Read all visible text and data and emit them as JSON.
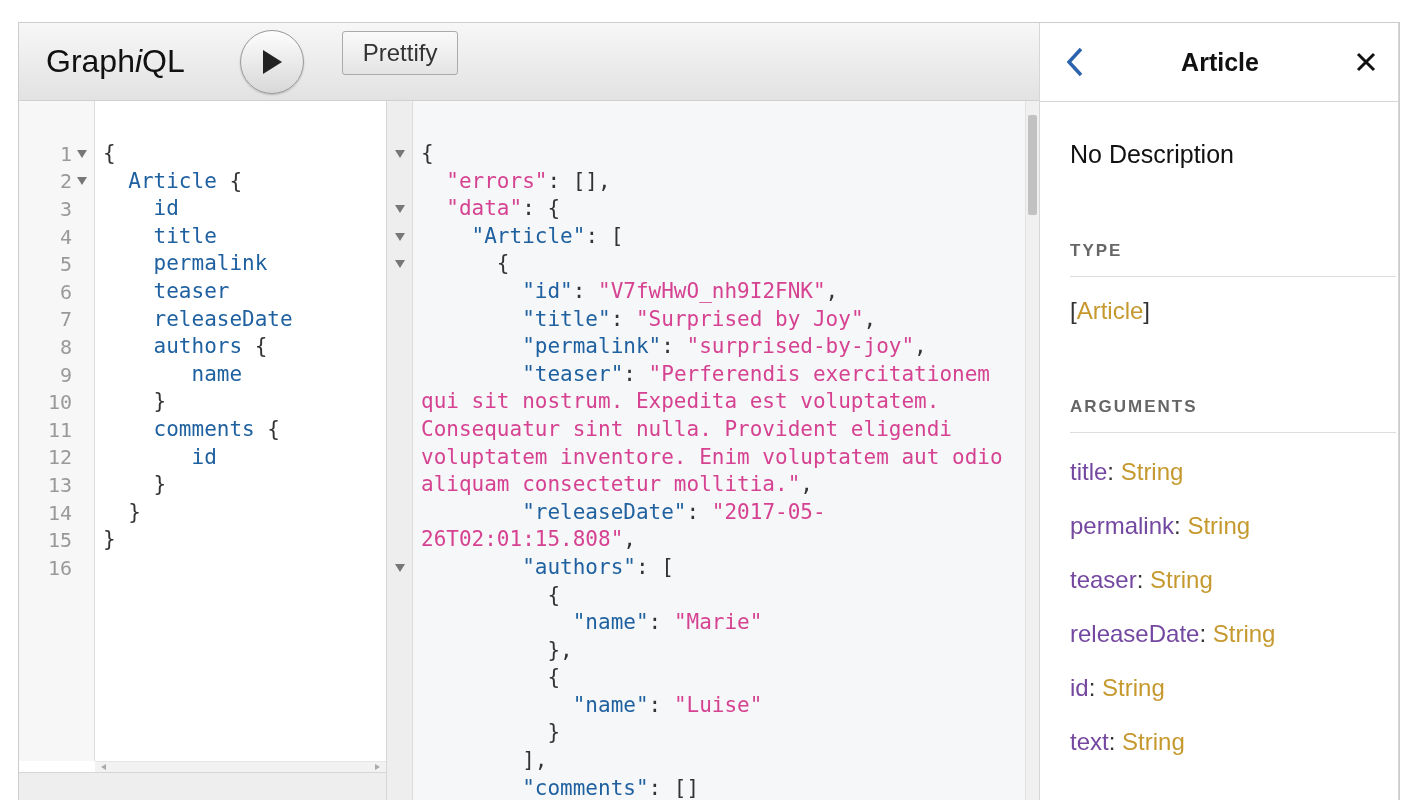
{
  "toolbar": {
    "logo": [
      {
        "text": "Graph",
        "italic": false
      },
      {
        "text": "i",
        "italic": true
      },
      {
        "text": "QL",
        "italic": false
      }
    ],
    "prettify_label": "Prettify"
  },
  "query_editor": {
    "lines": [
      {
        "number": "1",
        "fold": true,
        "tokens": [
          {
            "text": "{",
            "kind": "punct"
          }
        ]
      },
      {
        "number": "2",
        "fold": true,
        "tokens": [
          {
            "text": "  Article",
            "kind": "field"
          },
          {
            "text": " {",
            "kind": "punct"
          }
        ]
      },
      {
        "number": "3",
        "fold": false,
        "tokens": [
          {
            "text": "    id",
            "kind": "field"
          }
        ]
      },
      {
        "number": "4",
        "fold": false,
        "tokens": [
          {
            "text": "    title",
            "kind": "field"
          }
        ]
      },
      {
        "number": "5",
        "fold": false,
        "tokens": [
          {
            "text": "    permalink",
            "kind": "field"
          }
        ]
      },
      {
        "number": "6",
        "fold": false,
        "tokens": [
          {
            "text": "    teaser",
            "kind": "field"
          }
        ]
      },
      {
        "number": "7",
        "fold": false,
        "tokens": [
          {
            "text": "    releaseDate",
            "kind": "field"
          }
        ]
      },
      {
        "number": "8",
        "fold": false,
        "tokens": [
          {
            "text": "    authors",
            "kind": "field"
          },
          {
            "text": " {",
            "kind": "punct"
          }
        ]
      },
      {
        "number": "9",
        "fold": false,
        "tokens": [
          {
            "text": "       name",
            "kind": "field"
          }
        ]
      },
      {
        "number": "10",
        "fold": false,
        "tokens": [
          {
            "text": "    }",
            "kind": "punct"
          }
        ]
      },
      {
        "number": "11",
        "fold": false,
        "tokens": [
          {
            "text": "    comments",
            "kind": "field"
          },
          {
            "text": " {",
            "kind": "punct"
          }
        ]
      },
      {
        "number": "12",
        "fold": false,
        "tokens": [
          {
            "text": "       id",
            "kind": "field"
          }
        ]
      },
      {
        "number": "13",
        "fold": false,
        "tokens": [
          {
            "text": "    }",
            "kind": "punct"
          }
        ]
      },
      {
        "number": "14",
        "fold": false,
        "tokens": [
          {
            "text": "  }",
            "kind": "punct"
          }
        ]
      },
      {
        "number": "15",
        "fold": false,
        "tokens": [
          {
            "text": "}",
            "kind": "punct"
          }
        ]
      },
      {
        "number": "16",
        "fold": false
      }
    ]
  },
  "result_viewer": {
    "lines": [
      {
        "fold": true,
        "tokens": [
          {
            "text": "{",
            "kind": "punct"
          }
        ]
      },
      {
        "fold": false,
        "tokens": [
          {
            "text": "  \"errors\"",
            "kind": "string"
          },
          {
            "text": ": [],",
            "kind": "punct"
          }
        ]
      },
      {
        "fold": true,
        "tokens": [
          {
            "text": "  \"data\"",
            "kind": "string"
          },
          {
            "text": ": {",
            "kind": "punct"
          }
        ]
      },
      {
        "fold": true,
        "tokens": [
          {
            "text": "    \"Article\"",
            "kind": "key"
          },
          {
            "text": ": [",
            "kind": "punct"
          }
        ]
      },
      {
        "fold": true,
        "tokens": [
          {
            "text": "      {",
            "kind": "punct"
          }
        ]
      },
      {
        "fold": false,
        "tokens": [
          {
            "text": "        \"id\"",
            "kind": "key"
          },
          {
            "text": ": ",
            "kind": "punct"
          },
          {
            "text": "\"V7fwHwO_nh9I2FNK\"",
            "kind": "string"
          },
          {
            "text": ",",
            "kind": "punct"
          }
        ]
      },
      {
        "fold": false,
        "tokens": [
          {
            "text": "        \"title\"",
            "kind": "key"
          },
          {
            "text": ": ",
            "kind": "punct"
          },
          {
            "text": "\"Surprised by Joy\"",
            "kind": "string"
          },
          {
            "text": ",",
            "kind": "punct"
          }
        ]
      },
      {
        "fold": false,
        "tokens": [
          {
            "text": "        \"permalink\"",
            "kind": "key"
          },
          {
            "text": ": ",
            "kind": "punct"
          },
          {
            "text": "\"surprised-by-joy\"",
            "kind": "string"
          },
          {
            "text": ",",
            "kind": "punct"
          }
        ]
      },
      {
        "fold": false,
        "tokens": [
          {
            "text": "        \"teaser\"",
            "kind": "key"
          },
          {
            "text": ": ",
            "kind": "punct"
          },
          {
            "text": "\"Perferendis exercitationem",
            "kind": "string"
          }
        ]
      },
      {
        "fold": false,
        "tokens": [
          {
            "text": "qui sit nostrum. Expedita est voluptatem.",
            "kind": "string"
          }
        ]
      },
      {
        "fold": false,
        "tokens": [
          {
            "text": "Consequatur sint nulla. Provident eligendi",
            "kind": "string"
          }
        ]
      },
      {
        "fold": false,
        "tokens": [
          {
            "text": "voluptatem inventore. Enim voluptatem aut odio",
            "kind": "string"
          }
        ]
      },
      {
        "fold": false,
        "tokens": [
          {
            "text": "aliquam consectetur mollitia.\"",
            "kind": "string"
          },
          {
            "text": ",",
            "kind": "punct"
          }
        ]
      },
      {
        "fold": false,
        "tokens": [
          {
            "text": "        \"releaseDate\"",
            "kind": "key"
          },
          {
            "text": ": ",
            "kind": "punct"
          },
          {
            "text": "\"2017-05-",
            "kind": "string"
          }
        ]
      },
      {
        "fold": false,
        "tokens": [
          {
            "text": "26T02:01:15.808\"",
            "kind": "string"
          },
          {
            "text": ",",
            "kind": "punct"
          }
        ]
      },
      {
        "fold": true,
        "tokens": [
          {
            "text": "        \"authors\"",
            "kind": "key"
          },
          {
            "text": ": [",
            "kind": "punct"
          }
        ]
      },
      {
        "fold": false,
        "tokens": [
          {
            "text": "          {",
            "kind": "punct"
          }
        ]
      },
      {
        "fold": false,
        "tokens": [
          {
            "text": "            \"name\"",
            "kind": "key"
          },
          {
            "text": ": ",
            "kind": "punct"
          },
          {
            "text": "\"Marie\"",
            "kind": "string"
          }
        ]
      },
      {
        "fold": false,
        "tokens": [
          {
            "text": "          },",
            "kind": "punct"
          }
        ]
      },
      {
        "fold": false,
        "tokens": [
          {
            "text": "          {",
            "kind": "punct"
          }
        ]
      },
      {
        "fold": false,
        "tokens": [
          {
            "text": "            \"name\"",
            "kind": "key"
          },
          {
            "text": ": ",
            "kind": "punct"
          },
          {
            "text": "\"Luise\"",
            "kind": "string"
          }
        ]
      },
      {
        "fold": false,
        "tokens": [
          {
            "text": "          }",
            "kind": "punct"
          }
        ]
      },
      {
        "fold": false,
        "tokens": [
          {
            "text": "        ],",
            "kind": "punct"
          }
        ]
      },
      {
        "fold": false,
        "tokens": [
          {
            "text": "        \"comments\"",
            "kind": "key"
          },
          {
            "text": ": []",
            "kind": "punct"
          }
        ]
      }
    ]
  },
  "docs": {
    "title": "Article",
    "description": "No Description",
    "type_heading": "TYPE",
    "type": [
      {
        "text": "[",
        "kind": "punct"
      },
      {
        "text": "Article",
        "kind": "type"
      },
      {
        "text": "]",
        "kind": "punct"
      }
    ],
    "arguments_heading": "ARGUMENTS",
    "arguments": [
      {
        "name": "title",
        "separator": ":",
        "type": "String"
      },
      {
        "name": "permalink",
        "separator": ":",
        "type": "String"
      },
      {
        "name": "teaser",
        "separator": ":",
        "type": "String"
      },
      {
        "name": "releaseDate",
        "separator": ":",
        "type": "String"
      },
      {
        "name": "id",
        "separator": ":",
        "type": "String"
      },
      {
        "name": "text",
        "separator": ":",
        "type": "String"
      }
    ]
  }
}
